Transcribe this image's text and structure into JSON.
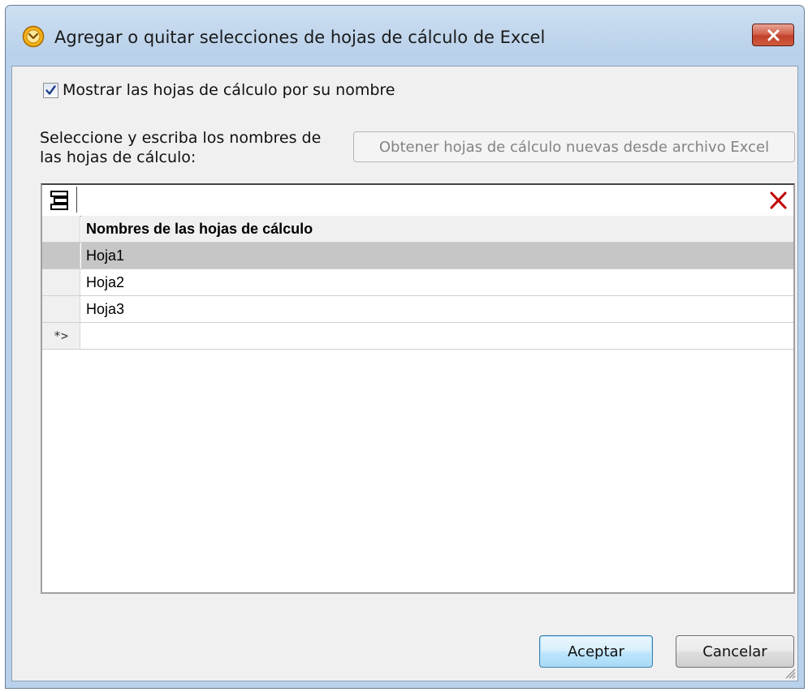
{
  "window": {
    "title": "Agregar o quitar selecciones de hojas de cálculo de Excel",
    "app_icon": "mapforce-clock-icon",
    "close_icon": "close-icon"
  },
  "options": {
    "show_by_name_label": "Mostrar las hojas de cálculo por su nombre",
    "show_by_name_checked": true
  },
  "instruction": "Seleccione y escriba los nombres de las hojas de cálculo:",
  "fetch_button_label": "Obtener hojas de cálculo nuevas desde archivo Excel",
  "grid": {
    "toolbar_left_icon": "append-row-icon",
    "toolbar_right_icon": "delete-icon",
    "column_header": "Nombres de las hojas de cálculo",
    "rows": [
      {
        "marker": "",
        "value": "Hoja1",
        "selected": true
      },
      {
        "marker": "",
        "value": "Hoja2",
        "selected": false
      },
      {
        "marker": "",
        "value": "Hoja3",
        "selected": false
      }
    ],
    "new_row_marker": "*>"
  },
  "buttons": {
    "ok": "Aceptar",
    "cancel": "Cancelar"
  },
  "colors": {
    "accent_close": "#c2412b",
    "selected_row": "#c6c6c6",
    "delete_icon": "#c00000"
  }
}
